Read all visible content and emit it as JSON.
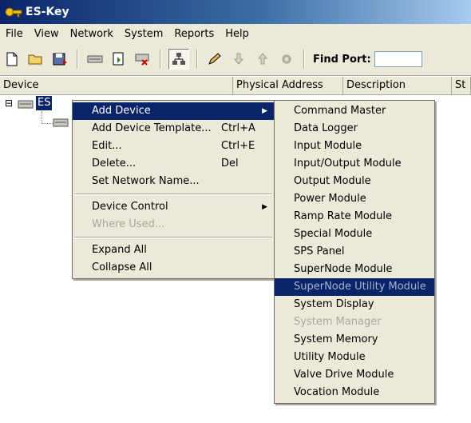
{
  "window": {
    "title": "ES-Key"
  },
  "menubar": {
    "items": [
      "File",
      "View",
      "Network",
      "System",
      "Reports",
      "Help"
    ]
  },
  "toolbar": {
    "find_port_label": "Find Port:",
    "find_port_value": ""
  },
  "columns": [
    "Device",
    "Physical Address",
    "Description",
    "St"
  ],
  "tree": {
    "root_label": "ES",
    "expander": "⊟"
  },
  "context_menu": {
    "items": [
      {
        "label": "Add Device",
        "shortcut": "",
        "submenu": true,
        "highlighted": true,
        "disabled": false
      },
      {
        "label": "Add Device Template...",
        "shortcut": "Ctrl+A",
        "submenu": false,
        "highlighted": false,
        "disabled": false
      },
      {
        "label": "Edit...",
        "shortcut": "Ctrl+E",
        "submenu": false,
        "highlighted": false,
        "disabled": false
      },
      {
        "label": "Delete...",
        "shortcut": "Del",
        "submenu": false,
        "highlighted": false,
        "disabled": false
      },
      {
        "label": "Set Network Name...",
        "shortcut": "",
        "submenu": false,
        "highlighted": false,
        "disabled": false
      },
      {
        "separator": true
      },
      {
        "label": "Device Control",
        "shortcut": "",
        "submenu": true,
        "highlighted": false,
        "disabled": false
      },
      {
        "label": "Where Used...",
        "shortcut": "",
        "submenu": false,
        "highlighted": false,
        "disabled": true
      },
      {
        "separator": true
      },
      {
        "label": "Expand All",
        "shortcut": "",
        "submenu": false,
        "highlighted": false,
        "disabled": false
      },
      {
        "label": "Collapse All",
        "shortcut": "",
        "submenu": false,
        "highlighted": false,
        "disabled": false
      }
    ]
  },
  "submenu": {
    "items": [
      {
        "label": "Command Master",
        "disabled": false,
        "highlighted": false
      },
      {
        "label": "Data Logger",
        "disabled": false,
        "highlighted": false
      },
      {
        "label": "Input Module",
        "disabled": false,
        "highlighted": false
      },
      {
        "label": "Input/Output Module",
        "disabled": false,
        "highlighted": false
      },
      {
        "label": "Output Module",
        "disabled": false,
        "highlighted": false
      },
      {
        "label": "Power Module",
        "disabled": false,
        "highlighted": false
      },
      {
        "label": "Ramp Rate Module",
        "disabled": false,
        "highlighted": false
      },
      {
        "label": "Special Module",
        "disabled": false,
        "highlighted": false
      },
      {
        "label": "SPS Panel",
        "disabled": false,
        "highlighted": false
      },
      {
        "label": "SuperNode Module",
        "disabled": false,
        "highlighted": false
      },
      {
        "label": "SuperNode Utility Module",
        "disabled": true,
        "highlighted": true
      },
      {
        "label": "System Display",
        "disabled": false,
        "highlighted": false
      },
      {
        "label": "System Manager",
        "disabled": true,
        "highlighted": false
      },
      {
        "label": "System Memory",
        "disabled": false,
        "highlighted": false
      },
      {
        "label": "Utility Module",
        "disabled": false,
        "highlighted": false
      },
      {
        "label": "Valve Drive Module",
        "disabled": false,
        "highlighted": false
      },
      {
        "label": "Vocation Module",
        "disabled": false,
        "highlighted": false
      }
    ]
  },
  "colors": {
    "highlight": "#0a246a",
    "menu_bg": "#ece9d8",
    "disabled": "#a7a6a0"
  }
}
